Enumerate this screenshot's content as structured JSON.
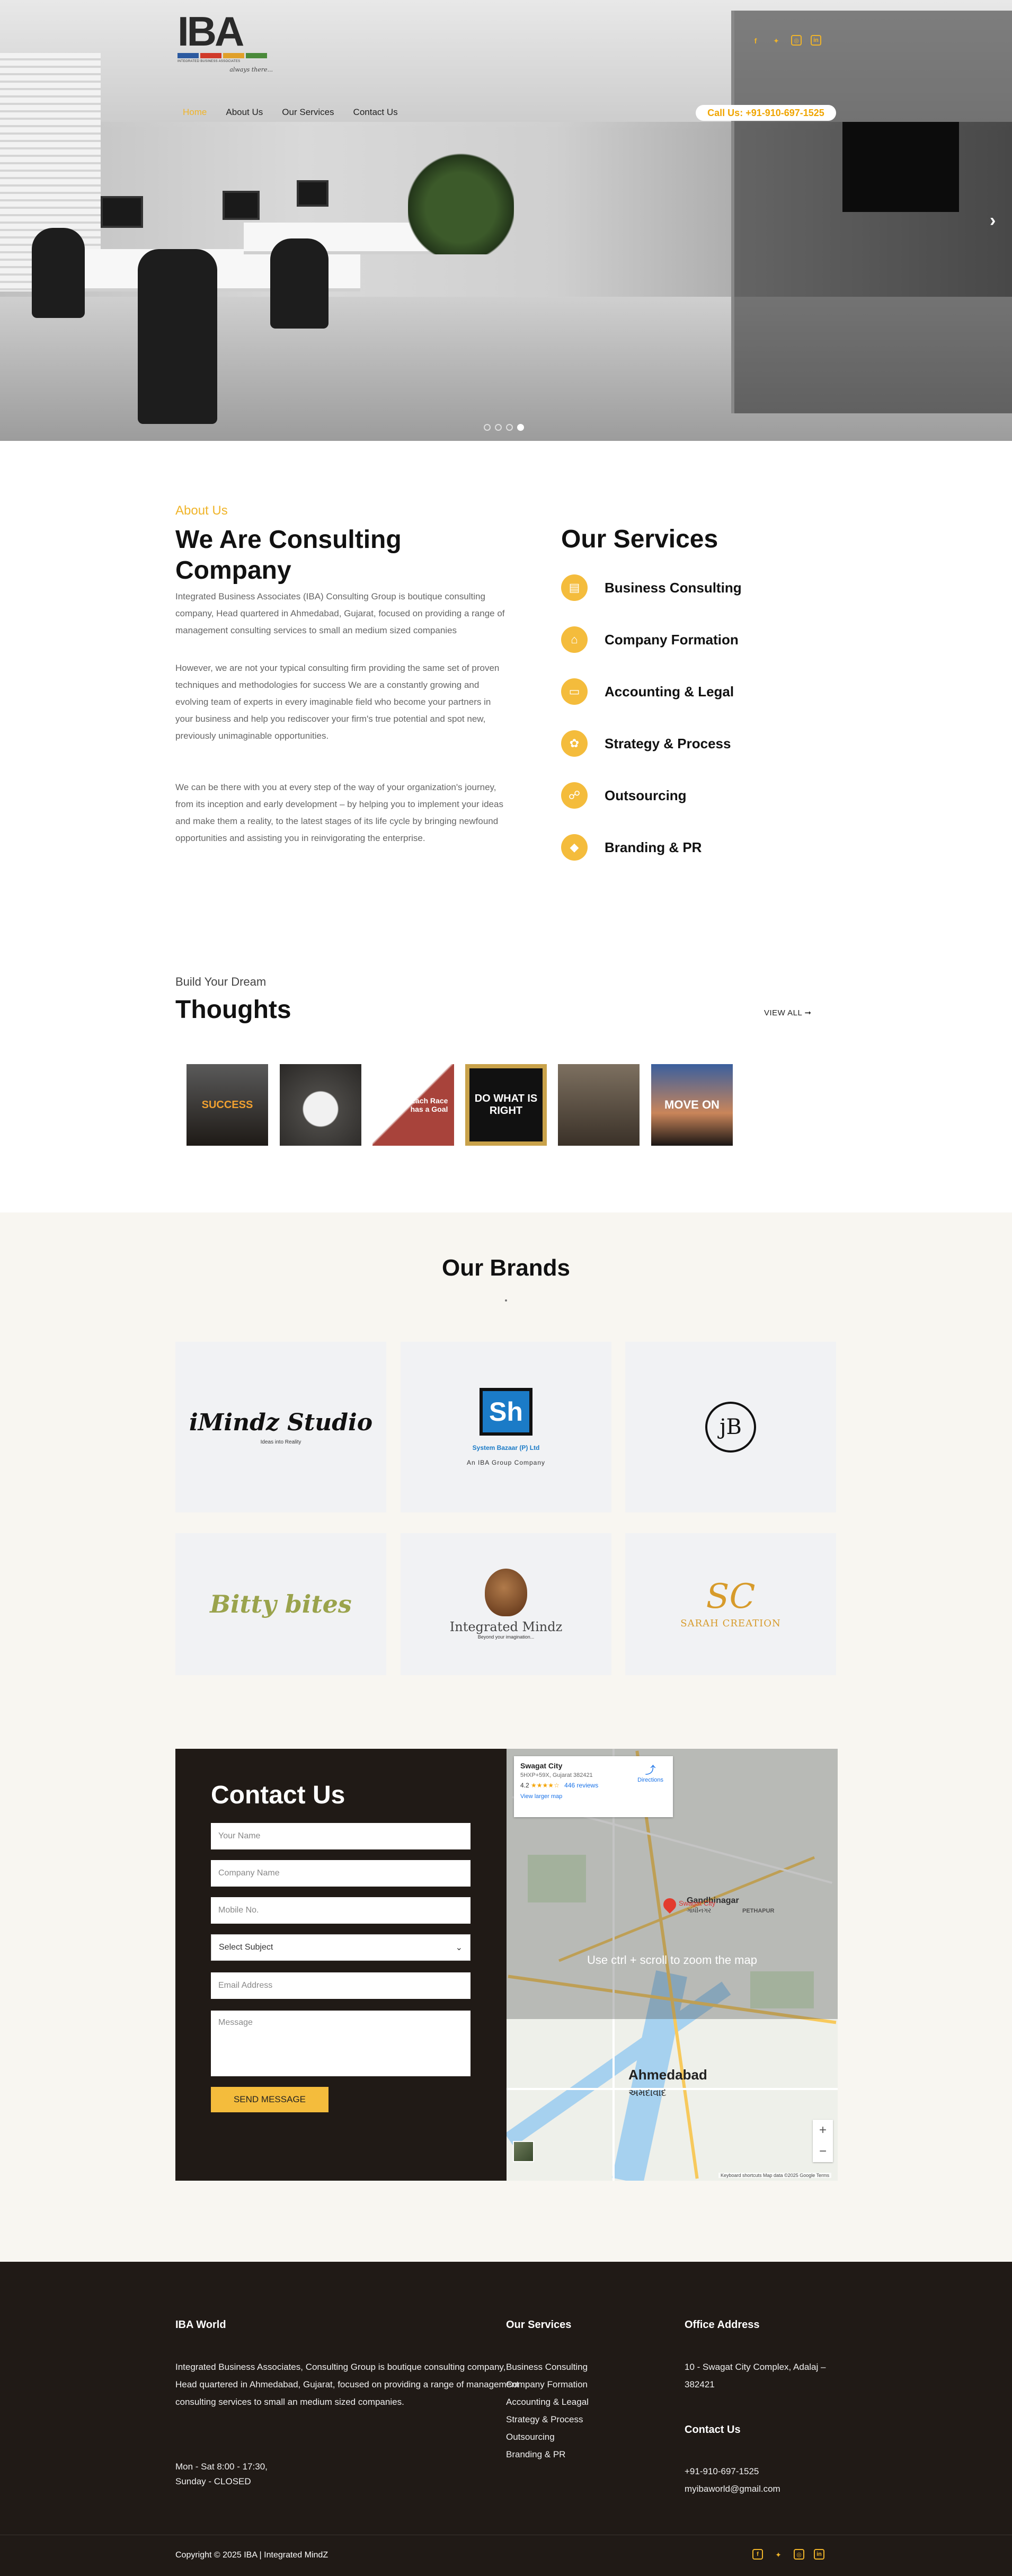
{
  "header": {
    "logo": {
      "mark": "IBA",
      "subtitle": "INTEGRATED BUSINESS ASSOCIATES",
      "tagline": "always there..."
    },
    "nav": [
      "Home",
      "About Us",
      "Our Services",
      "Contact Us"
    ],
    "call": "Call Us: +91-910-697-1525",
    "social_icons": [
      "facebook-icon",
      "twitter-icon",
      "instagram-icon",
      "linkedin-icon"
    ],
    "hero_arrow": "›",
    "slider_dots": 4,
    "active_dot": 4
  },
  "about": {
    "label": "About Us",
    "title": "We Are Consulting Company",
    "paragraphs": [
      "Integrated Business Associates (IBA) Consulting Group is boutique consulting company, Head quartered in Ahmedabad, Gujarat, focused on providing a range of management consulting services to small an medium sized companies",
      "However, we are not your typical consulting firm providing the same set of proven techniques and methodologies for success We are a constantly growing and evolving team of experts in every imaginable field who become your partners in your business and help you rediscover your firm's true potential and spot new, previously unimaginable opportunities.",
      "We can be there with you at every step of the way of your organization's journey, from its inception and early development – by helping you to implement your ideas and make them a reality, to the latest stages of its life cycle by bringing newfound opportunities and assisting you in reinvigorating the enterprise."
    ]
  },
  "services": {
    "title": "Our Services",
    "items": [
      {
        "label": "Business Consulting",
        "icon": "briefcase-icon"
      },
      {
        "label": "Company Formation",
        "icon": "bank-icon"
      },
      {
        "label": "Accounting & Legal",
        "icon": "money-icon"
      },
      {
        "label": "Strategy & Process",
        "icon": "brain-icon"
      },
      {
        "label": "Outsourcing",
        "icon": "handshake-icon"
      },
      {
        "label": "Branding & PR",
        "icon": "diamond-icon"
      }
    ]
  },
  "thoughts": {
    "subtitle": "Build Your Dream",
    "title": "Thoughts",
    "view_all": "VIEW ALL ➞",
    "cards": [
      {
        "text": "SUCCESS",
        "bg": "#2a2622",
        "color": "#f0a030"
      },
      {
        "text": "",
        "bg": "#3e3c3a",
        "color": "#ffffff"
      },
      {
        "text": "Each Race has a Goal",
        "bg": "#a8433b",
        "color": "#ffffff"
      },
      {
        "text": "DO WHAT IS RIGHT",
        "bg": "#111111",
        "color": "#ffffff"
      },
      {
        "text": "",
        "bg": "#6a5a48",
        "color": "#ffffff"
      },
      {
        "text": "MOVE ON",
        "bg": "#2b3a5c",
        "color": "#ffffff"
      }
    ]
  },
  "brands": {
    "title": "Our Brands",
    "items": [
      {
        "name": "iMindz Studio",
        "sub": "Ideas into Reality",
        "color": "#111111"
      },
      {
        "name": "Sh",
        "sub": "System Bazaar (P) Ltd",
        "sub2": "An IBA Group Company",
        "color": "#1b7bc7"
      },
      {
        "name": "jB",
        "sub": "",
        "color": "#111111"
      },
      {
        "name": "Bitty bites",
        "sub": "",
        "color": "#9aa34c"
      },
      {
        "name": "Integrated Mindz",
        "sub": "Beyond your imagination...",
        "color": "#7a4a22"
      },
      {
        "name": "SC",
        "sub": "SARAH CREATION",
        "color": "#d79b2b"
      }
    ]
  },
  "contact": {
    "title": "Contact Us",
    "name_placeholder": "Your Name",
    "company_placeholder": "Company Name",
    "mobile_placeholder": "Mobile No.",
    "subject_value": "Select Subject",
    "email_placeholder": "Email Address",
    "message_placeholder": "Message",
    "send": "SEND MESSAGE"
  },
  "map": {
    "place": "Swagat City",
    "address": "5HXP+59X, Gujarat 382421",
    "rating": "4.2",
    "stars": "★★★★☆",
    "reviews": "446 reviews",
    "directions": "Directions",
    "larger": "View larger map",
    "hint": "Use ctrl + scroll to zoom the map",
    "pin_label": "Swagat City",
    "city1": "Gandhinagar",
    "city1_local": "ગાંધીનગર",
    "city2": "Ahmedabad",
    "city2_local": "અમદાવાદ",
    "city3": "PETHAPUR",
    "zoom_in": "+",
    "zoom_out": "−",
    "footer": "Keyboard shortcuts   Map data ©2025 Google   Terms"
  },
  "footer": {
    "col1_title": "IBA World",
    "col1_text": "Integrated Business Associates, Consulting Group is boutique consulting company, Head quartered in Ahmedabad, Gujarat, focused on providing a range of management consulting services to small an medium sized companies.",
    "hours1": "Mon - Sat 8:00 - 17:30,",
    "hours2": "Sunday - CLOSED",
    "col2_title": "Our Services",
    "col2_items": [
      "Business Consulting",
      "Company Formation",
      "Accounting & Leagal",
      "Strategy & Process",
      "Outsourcing",
      "Branding & PR"
    ],
    "col3_title": "Office Address",
    "address": "10 - Swagat City Complex, Adalaj – 382421",
    "contact_title": "Contact Us",
    "phone": "+91-910-697-1525",
    "email": "myibaworld@gmail.com",
    "copyright": "Copyright © 2025 IBA | Integrated MindZ"
  },
  "colors": {
    "accent": "#f4bc3c",
    "dark": "#201a16",
    "brands_bg": "#f8f6f1"
  }
}
